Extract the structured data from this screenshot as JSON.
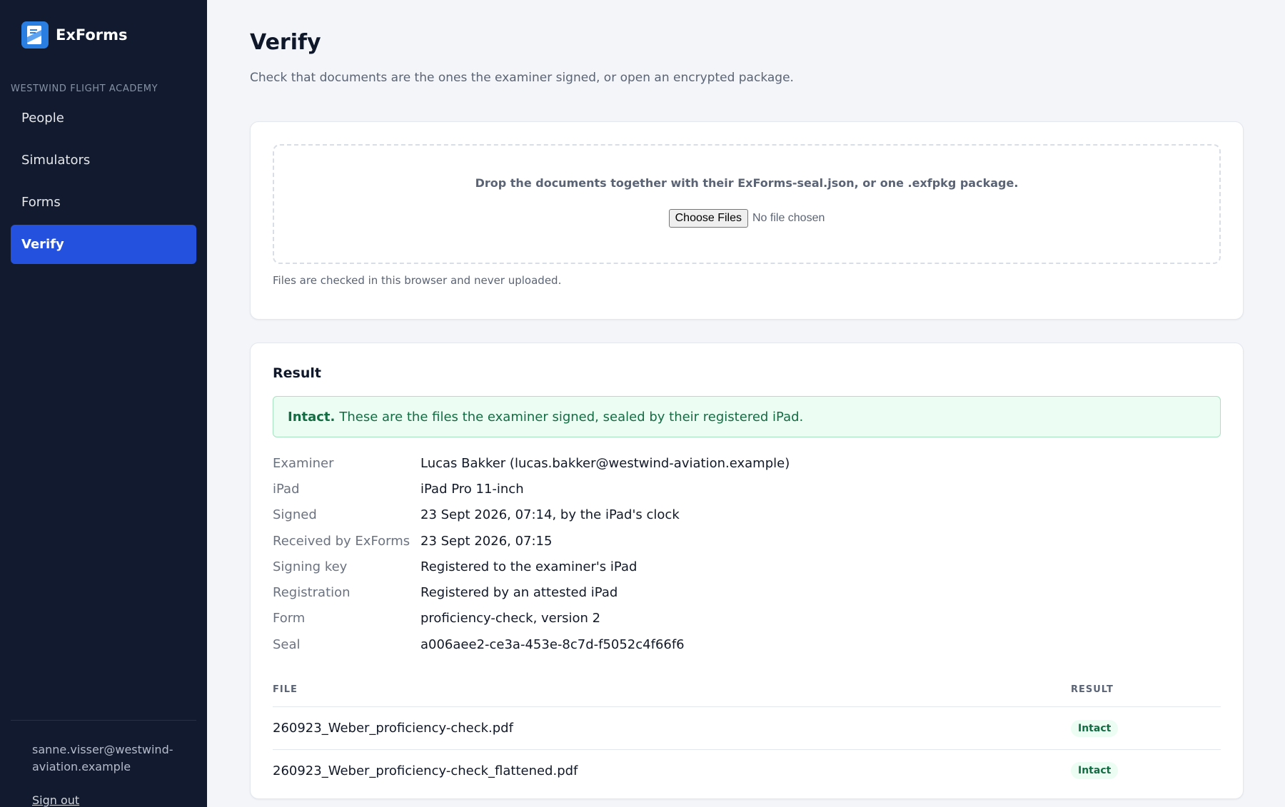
{
  "app": {
    "name": "ExForms",
    "logo_icon": "document-logo-icon",
    "accent_color": "#2451de"
  },
  "sidebar": {
    "org": "WESTWIND FLIGHT ACADEMY",
    "items": [
      {
        "label": "People"
      },
      {
        "label": "Simulators"
      },
      {
        "label": "Forms"
      },
      {
        "label": "Verify",
        "active": true
      }
    ],
    "user_email": "sanne.visser@westwind-aviation.example",
    "sign_out": "Sign out"
  },
  "page": {
    "title": "Verify",
    "subtitle": "Check that documents are the ones the examiner signed, or open an encrypted package."
  },
  "upload": {
    "drop_text": "Drop the documents together with their ExForms-seal.json, or one .exfpkg package.",
    "button_label": "Choose Files",
    "file_status": "No file chosen",
    "note": "Files are checked in this browser and never uploaded."
  },
  "result": {
    "title": "Result",
    "banner_strong": "Intact.",
    "banner_text": "These are the files the examiner signed, sealed by their registered iPad.",
    "banner_color": "#146c43",
    "details": [
      {
        "key": "Examiner",
        "value": "Lucas Bakker (lucas.bakker@westwind-aviation.example)"
      },
      {
        "key": "iPad",
        "value": "iPad Pro 11-inch"
      },
      {
        "key": "Signed",
        "value": "23 Sept 2026, 07:14, by the iPad's clock"
      },
      {
        "key": "Received by ExForms",
        "value": "23 Sept 2026, 07:15"
      },
      {
        "key": "Signing key",
        "value": "Registered to the examiner's iPad"
      },
      {
        "key": "Registration",
        "value": "Registered by an attested iPad"
      },
      {
        "key": "Form",
        "value": "proficiency-check, version 2"
      },
      {
        "key": "Seal",
        "value": "a006aee2-ce3a-453e-8c7d-f5052c4f66f6"
      }
    ],
    "table": {
      "headers": {
        "file": "FILE",
        "result": "RESULT"
      },
      "rows": [
        {
          "file": "260923_Weber_proficiency-check.pdf",
          "result": "Intact"
        },
        {
          "file": "260923_Weber_proficiency-check_flattened.pdf",
          "result": "Intact"
        }
      ]
    }
  }
}
